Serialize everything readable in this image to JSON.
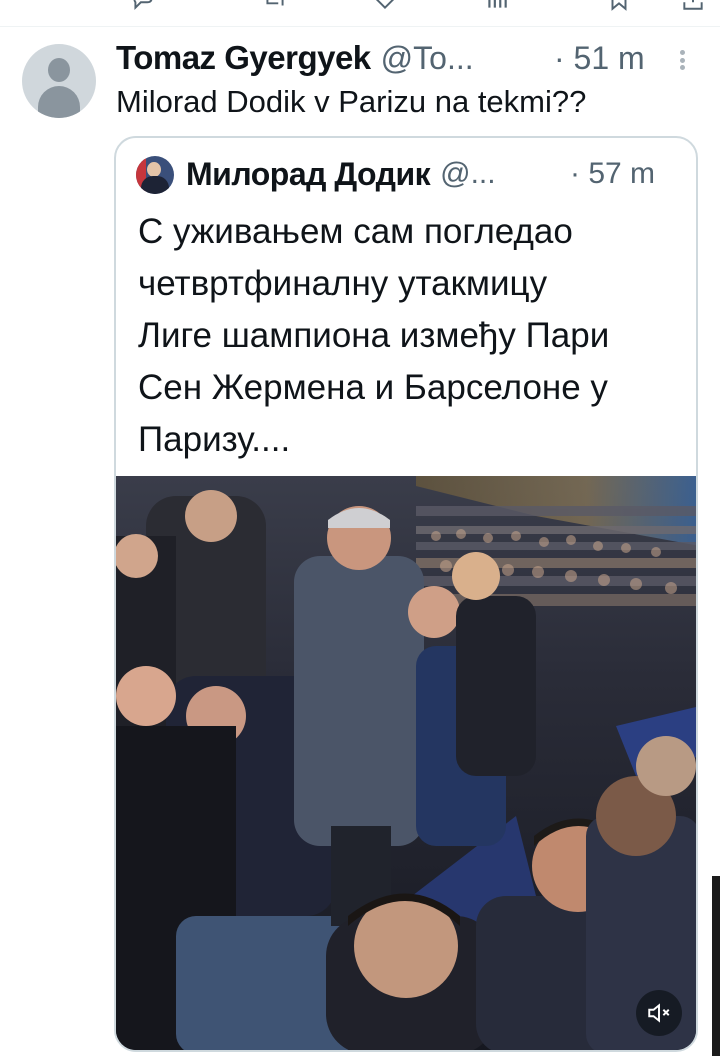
{
  "tweet": {
    "author_name": "Tomaz Gyergyek",
    "handle": "@To...",
    "time": "· 51 m",
    "text": "Milorad Dodik v Parizu na tekmi??"
  },
  "quoted_tweet": {
    "author_name": "Милорад Додик",
    "handle": "@...",
    "time": "· 57 m",
    "text_lines": [
      "С уживањем сам погледао",
      "четвртфиналну утакмицу",
      "Лиге шампиона између Пари",
      "Сен Жермена и Барселоне у",
      "Паризу...."
    ]
  },
  "media": {
    "type": "video",
    "mute_icon": "volume-muted-icon"
  },
  "icons": {
    "avatar": "default-avatar-icon",
    "more": "more-vertical-icon"
  },
  "colors": {
    "text": "#0f1419",
    "secondary": "#536471",
    "border": "#cfd9de"
  }
}
